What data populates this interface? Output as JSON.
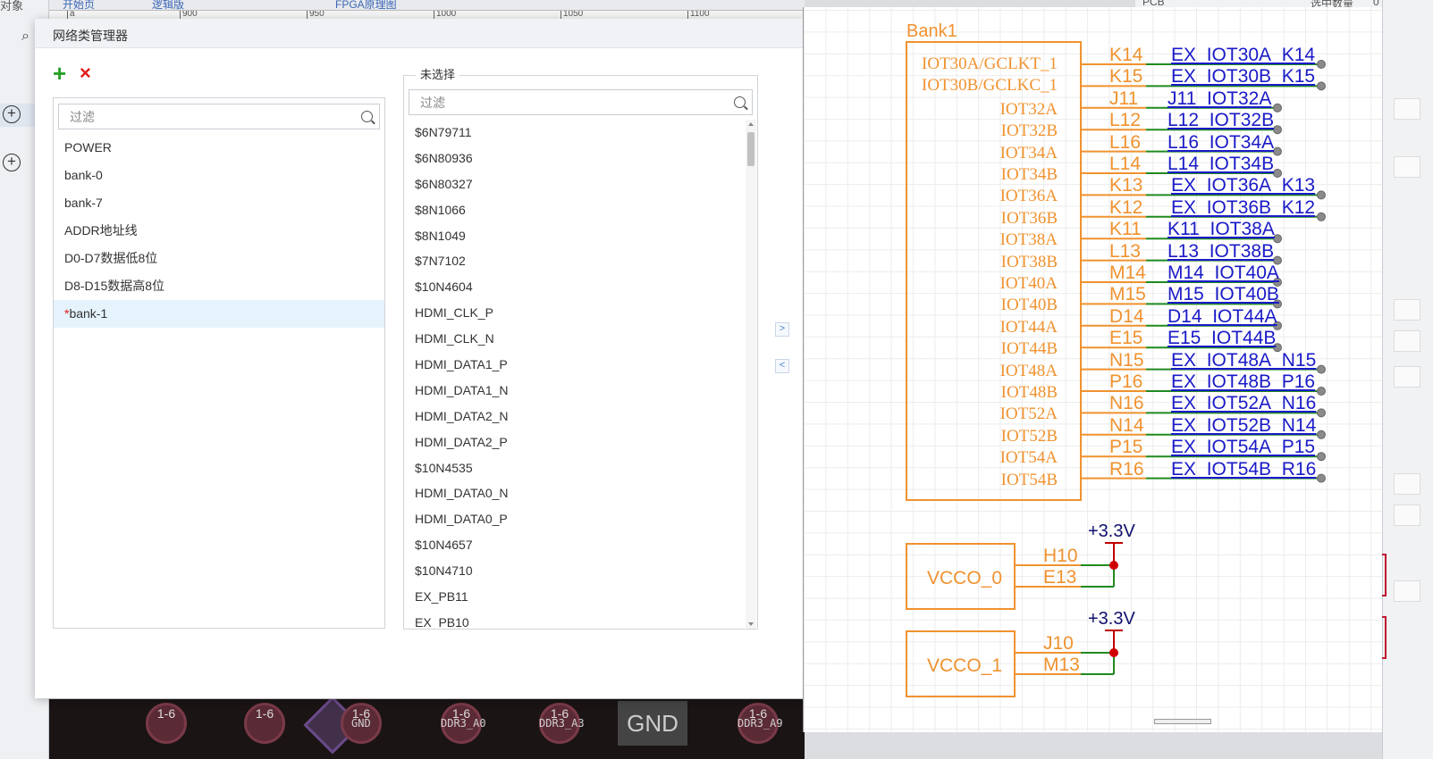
{
  "background": {
    "left_title": "对象",
    "tabs": [
      "开始页",
      "逻辑版",
      "FPGA原理图"
    ],
    "ruler_ticks": [
      "a",
      "900",
      "950",
      "1000",
      "1050",
      "1100"
    ],
    "topright_labels": [
      "PCB",
      "选中数量",
      "0"
    ],
    "pcb_labels": [
      "1-6",
      "1-6",
      "1-6",
      "1-6",
      "1-6",
      "1-6"
    ],
    "pcb_gnd_label": "GND",
    "pcb_small_labels": [
      "GND",
      "DDR3_A0",
      "DDR3_A3",
      "DDR3_A9"
    ]
  },
  "dialog": {
    "title": "网络类管理器",
    "add_icon": "+",
    "delete_icon": "×",
    "class_filter_placeholder": "过滤",
    "net_filter_placeholder": "过滤",
    "net_group_label": "未选择",
    "move_right": ">",
    "move_left": "<",
    "classes": [
      {
        "label": "POWER",
        "modified": false
      },
      {
        "label": "bank-0",
        "modified": false
      },
      {
        "label": "bank-7",
        "modified": false
      },
      {
        "label": "ADDR地址线",
        "modified": false
      },
      {
        "label": "D0-D7数据低8位",
        "modified": false
      },
      {
        "label": "D8-D15数据高8位",
        "modified": false
      },
      {
        "label": "bank-1",
        "modified": true,
        "selected": true
      }
    ],
    "modified_marker": "*",
    "nets": [
      "$6N79711",
      "$6N80936",
      "$6N80327",
      "$8N1066",
      "$8N1049",
      "$7N7102",
      "$10N4604",
      "HDMI_CLK_P",
      "HDMI_CLK_N",
      "HDMI_DATA1_P",
      "HDMI_DATA1_N",
      "HDMI_DATA2_N",
      "HDMI_DATA2_P",
      "$10N4535",
      "HDMI_DATA0_N",
      "HDMI_DATA0_P",
      "$10N4657",
      "$10N4710",
      "EX_PB11",
      "EX_PB10"
    ]
  },
  "schematic": {
    "bank_title": "Bank1",
    "pins": [
      {
        "name": "IOT30A/GCLKT_1",
        "num": "K14",
        "net": "EX_IOT30A_K14"
      },
      {
        "name": "IOT30B/GCLKC_1",
        "num": "K15",
        "net": "EX_IOT30B_K15"
      },
      {
        "name": "IOT32A",
        "num": "J11",
        "net": "J11_IOT32A"
      },
      {
        "name": "IOT32B",
        "num": "L12",
        "net": "L12_IOT32B"
      },
      {
        "name": "IOT34A",
        "num": "L16",
        "net": "L16_IOT34A"
      },
      {
        "name": "IOT34B",
        "num": "L14",
        "net": "L14_IOT34B"
      },
      {
        "name": "IOT36A",
        "num": "K13",
        "net": "EX_IOT36A_K13"
      },
      {
        "name": "IOT36B",
        "num": "K12",
        "net": "EX_IOT36B_K12"
      },
      {
        "name": "IOT38A",
        "num": "K11",
        "net": "K11_IOT38A"
      },
      {
        "name": "IOT38B",
        "num": "L13",
        "net": "L13_IOT38B"
      },
      {
        "name": "IOT40A",
        "num": "M14",
        "net": "M14_IOT40A"
      },
      {
        "name": "IOT40B",
        "num": "M15",
        "net": "M15_IOT40B"
      },
      {
        "name": "IOT44A",
        "num": "D14",
        "net": "D14_IOT44A"
      },
      {
        "name": "IOT44B",
        "num": "E15",
        "net": "E15_IOT44B"
      },
      {
        "name": "IOT48A",
        "num": "N15",
        "net": "EX_IOT48A_N15"
      },
      {
        "name": "IOT48B",
        "num": "P16",
        "net": "EX_IOT48B_P16"
      },
      {
        "name": "IOT52A",
        "num": "N16",
        "net": "EX_IOT52A_N16"
      },
      {
        "name": "IOT52B",
        "num": "N14",
        "net": "EX_IOT52B_N14"
      },
      {
        "name": "IOT54A",
        "num": "P15",
        "net": "EX_IOT54A_P15"
      },
      {
        "name": "IOT54B",
        "num": "R16",
        "net": "EX_IOT54B_R16"
      }
    ],
    "vcco": [
      {
        "name": "VCCO_0",
        "pins": [
          "H10",
          "E13"
        ],
        "power": "+3.3V"
      },
      {
        "name": "VCCO_1",
        "pins": [
          "J10",
          "M13"
        ],
        "power": "+3.3V"
      }
    ],
    "colors": {
      "component": "#f0922f",
      "wire": "#1f8a1f",
      "net": "#1a1ac8",
      "power": "#c00000"
    }
  }
}
